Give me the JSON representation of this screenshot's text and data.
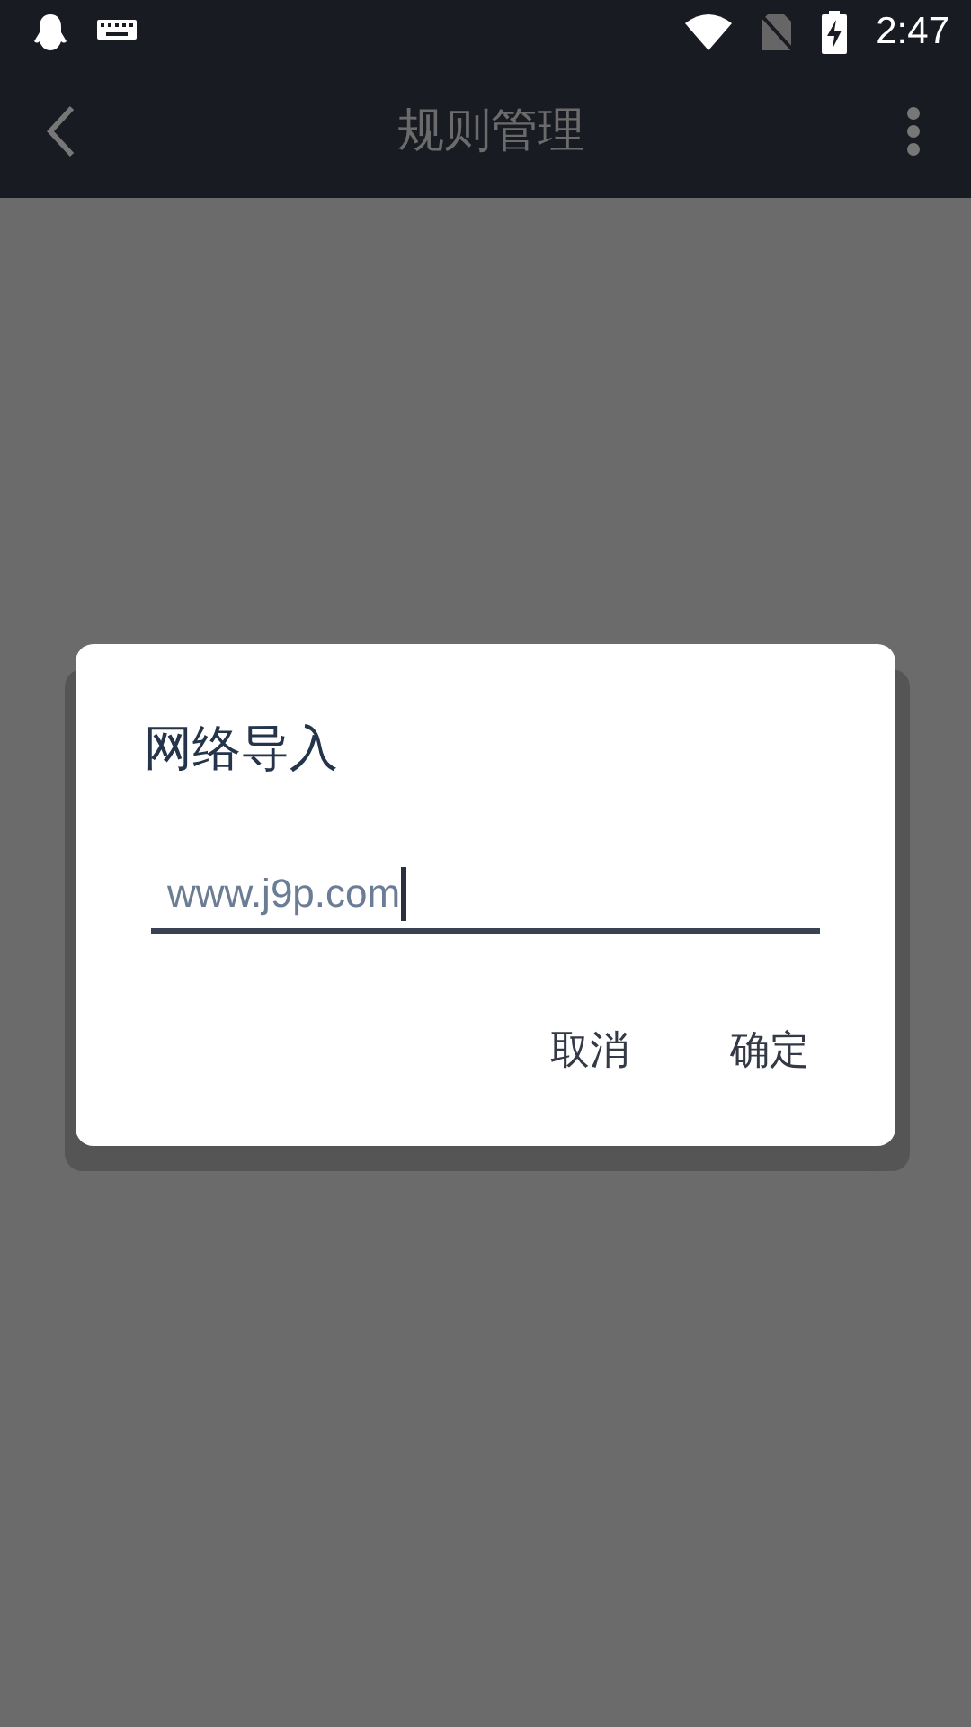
{
  "status_bar": {
    "time": "2:47"
  },
  "app_bar": {
    "title": "规则管理"
  },
  "dialog": {
    "title": "网络导入",
    "field": {
      "value": "www.j9p.com",
      "focused": true
    },
    "buttons": [
      "取消",
      "确定"
    ]
  }
}
